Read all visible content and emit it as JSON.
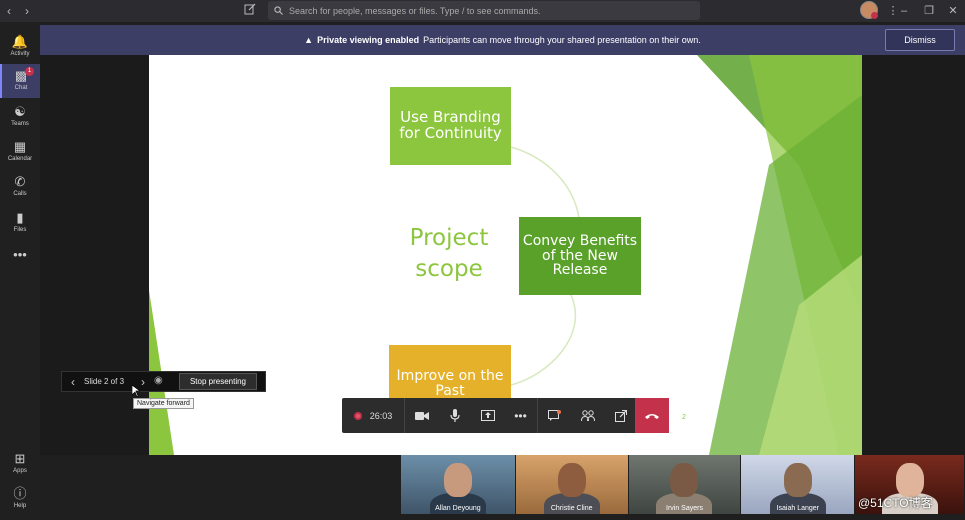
{
  "topbar": {
    "search_placeholder": "Search for people, messages or files. Type / to see commands."
  },
  "rail": {
    "items": [
      {
        "label": "Activity",
        "icon": "bell-icon"
      },
      {
        "label": "Chat",
        "icon": "chat-icon",
        "badge": "1"
      },
      {
        "label": "Teams",
        "icon": "teams-icon"
      },
      {
        "label": "Calendar",
        "icon": "calendar-icon"
      },
      {
        "label": "Calls",
        "icon": "phone-icon"
      },
      {
        "label": "Files",
        "icon": "file-icon"
      },
      {
        "label": "Apps",
        "icon": "apps-icon"
      },
      {
        "label": "Help",
        "icon": "help-icon"
      }
    ]
  },
  "banner": {
    "bold": "Private viewing enabled",
    "text": "Participants can move through your shared presentation on their own.",
    "dismiss": "Dismiss"
  },
  "slide": {
    "box1": "Use Branding for Continuity",
    "box2": "Convey Benefits of the New Release",
    "box3": "Improve on the Past",
    "title_line1": "Project",
    "title_line2": "scope",
    "page_number": "2",
    "colors": {
      "green_light": "#8cc63e",
      "green_dark": "#5aa12a",
      "gold": "#e5b12a"
    }
  },
  "presenter": {
    "slide_counter": "Slide 2 of 3",
    "stop": "Stop presenting",
    "tooltip": "Navigate forward"
  },
  "callbar": {
    "timer": "26:03",
    "hangup_color": "#c4314b"
  },
  "participants": [
    {
      "name": "Allan Deyoung"
    },
    {
      "name": "Christie Cline"
    },
    {
      "name": "Irvin Sayers"
    },
    {
      "name": "Isaiah Langer"
    },
    {
      "name": ""
    }
  ],
  "watermark": "@51CTO博客"
}
